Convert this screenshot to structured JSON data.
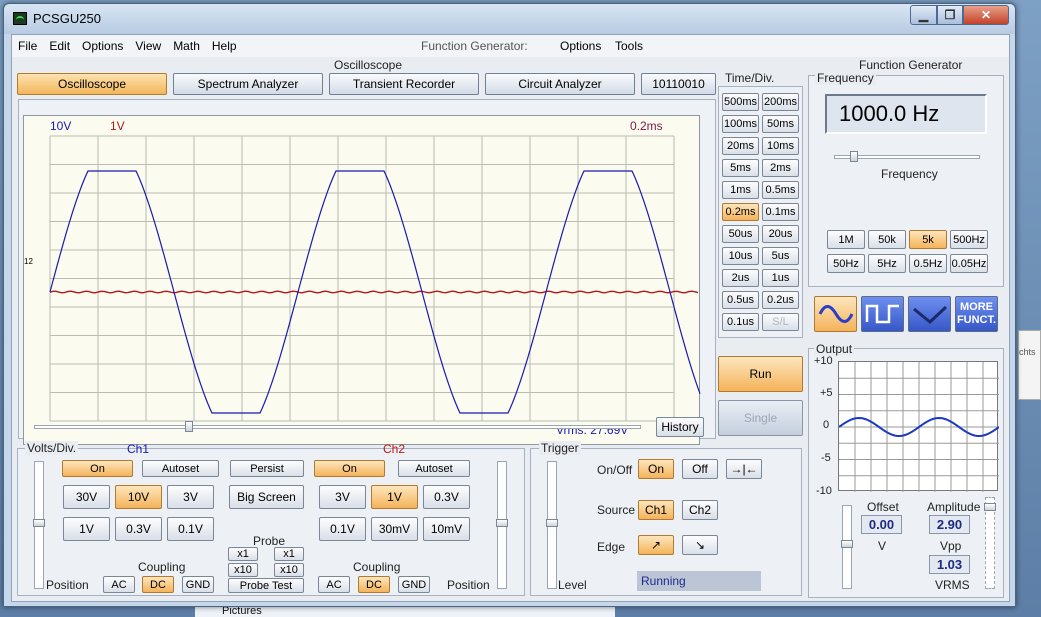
{
  "window": {
    "title": "PCSGU250"
  },
  "menu": {
    "file": "File",
    "edit": "Edit",
    "options": "Options",
    "view": "View",
    "math": "Math",
    "help": "Help",
    "fg_label": "Function Generator:",
    "fg_options": "Options",
    "fg_tools": "Tools"
  },
  "headers": {
    "oscilloscope": "Oscilloscope",
    "function_generator": "Function Generator"
  },
  "tabs": [
    "Oscilloscope",
    "Spectrum Analyzer",
    "Transient Recorder",
    "Circuit Analyzer",
    "10110010"
  ],
  "scope": {
    "ch1_volts": "10V",
    "ch2_volts": "1V",
    "timebase": "0.2ms",
    "vrms": "Vrms: 27.69V",
    "marker": "12",
    "history_label": "History",
    "ch1_color": "#1a1ab0",
    "ch2_color": "#b01a1a"
  },
  "timediv": {
    "label": "Time/Div.",
    "buttons": [
      [
        "500ms",
        "200ms"
      ],
      [
        "100ms",
        "50ms"
      ],
      [
        "20ms",
        "10ms"
      ],
      [
        "5ms",
        "2ms"
      ],
      [
        "1ms",
        "0.5ms"
      ],
      [
        "0.2ms",
        "0.1ms"
      ],
      [
        "50us",
        "20us"
      ],
      [
        "10us",
        "5us"
      ],
      [
        "2us",
        "1us"
      ],
      [
        "0.5us",
        "0.2us"
      ],
      [
        "0.1us",
        "S/L"
      ]
    ],
    "selected": "0.2ms"
  },
  "run": "Run",
  "single": "Single",
  "volts": {
    "label": "Volts/Div.",
    "ch1": "Ch1",
    "ch2": "Ch2",
    "on": "On",
    "autoset": "Autoset",
    "persist": "Persist",
    "big_screen": "Big Screen",
    "ch1_ranges": [
      "30V",
      "10V",
      "3V",
      "1V",
      "0.3V",
      "0.1V"
    ],
    "ch2_ranges": [
      "3V",
      "1V",
      "0.3V",
      "0.1V",
      "30mV",
      "10mV"
    ],
    "probe": "Probe",
    "x1": "x1",
    "x10": "x10",
    "probe_test": "Probe Test",
    "coupling": "Coupling",
    "ac": "AC",
    "dc": "DC",
    "gnd": "GND",
    "position": "Position"
  },
  "trigger": {
    "label": "Trigger",
    "onoff": "On/Off",
    "on": "On",
    "off": "Off",
    "source": "Source",
    "ch1": "Ch1",
    "ch2": "Ch2",
    "edge": "Edge",
    "level": "Level",
    "status": "Running"
  },
  "fg": {
    "frequency_label": "Frequency",
    "frequency_value": "1000.0 Hz",
    "slider_label": "Frequency",
    "ranges": [
      [
        "1M",
        "50k",
        "5k",
        "500Hz"
      ],
      [
        "50Hz",
        "5Hz",
        "0.5Hz",
        "0.05Hz"
      ]
    ],
    "selected_range": "5k",
    "more": "MORE FUNCT.",
    "output": "Output",
    "output_ticks": [
      "+10",
      "+5",
      "0",
      "-5",
      "-10"
    ],
    "offset_label": "Offset",
    "offset_value": "0.00",
    "offset_unit": "V",
    "amplitude_label": "Amplitude",
    "amplitude_value": "2.90",
    "vpp": "Vpp",
    "vrms_value": "1.03",
    "vrms": "VRMS"
  },
  "desktop": {
    "taskbar_item": "Pictures",
    "edge_text": "chts"
  }
}
